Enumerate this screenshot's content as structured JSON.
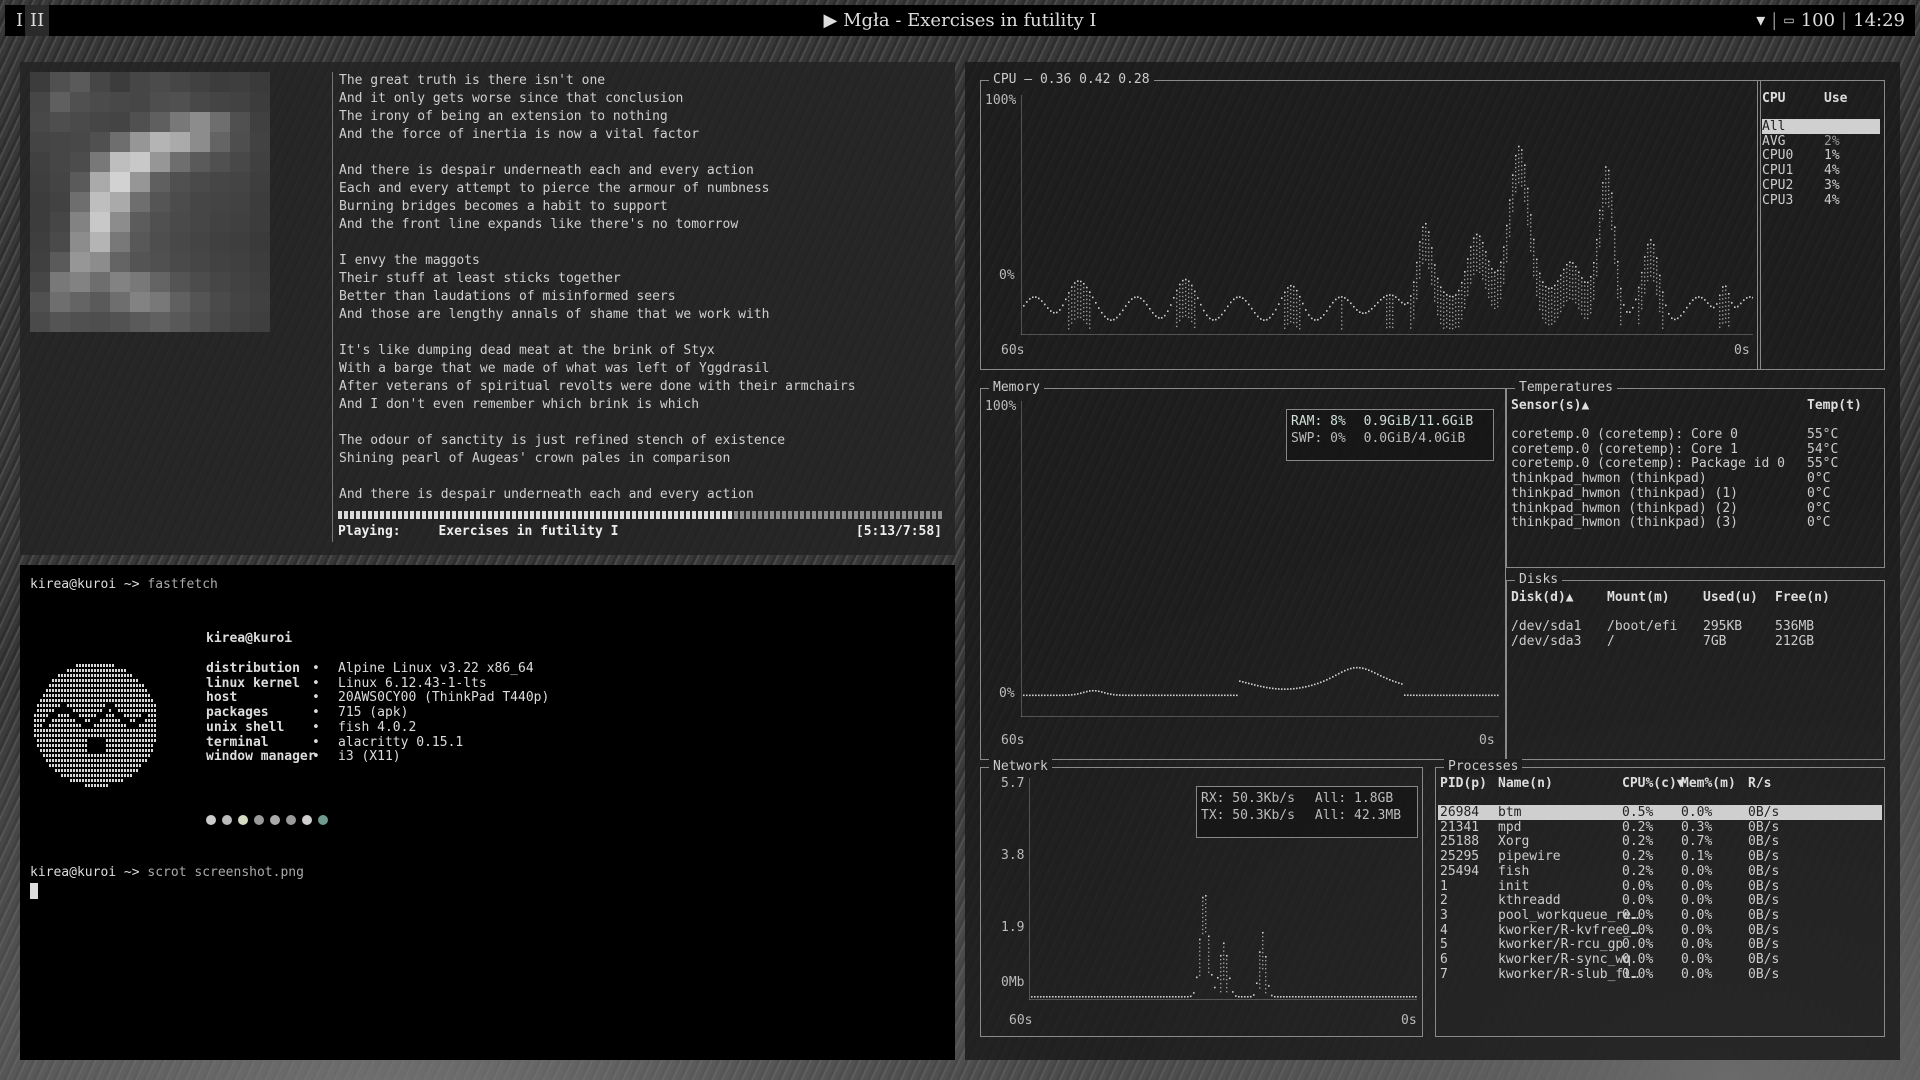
{
  "topbar": {
    "ws1": "I",
    "ws2": "II",
    "title": "▶ Mgła - Exercises in futility I",
    "battery": "100",
    "clock": "14:29"
  },
  "music": {
    "lyrics": [
      "The great truth is there isn't one",
      "And it only gets worse since that conclusion",
      "The irony of being an extension to nothing",
      "And the force of inertia is now a vital factor",
      "",
      "And there is despair underneath each and every action",
      "Each and every attempt to pierce the armour of numbness",
      "Burning bridges becomes a habit to support",
      "And the front line expands like there's no tomorrow",
      "",
      "I envy the maggots",
      "Their stuff at least sticks together",
      "Better than laudations of misinformed seers",
      "And those are lengthy annals of shame that we work with",
      "",
      "It's like dumping dead meat at the brink of Styx",
      "With a barge that we made of what was left of Yggdrasil",
      "After veterans of spiritual revolts were done with their armchairs",
      "And I don't even remember which brink is which",
      "",
      "The odour of sanctity is just refined stench of existence",
      "Shining pearl of Augeas' crown pales in comparison",
      "",
      "And there is despair underneath each and every action"
    ],
    "playing_label": "Playing:",
    "track": "Exercises in futility I",
    "time": "[5:13/7:58]",
    "progress": 0.655
  },
  "terminal": {
    "prompt1": "kirea@kuroi ~> ",
    "cmd1": "fastfetch",
    "user_host": "kirea@kuroi",
    "info": [
      {
        "label": "distribution",
        "value": "Alpine Linux v3.22 x86_64"
      },
      {
        "label": "linux kernel",
        "value": "Linux 6.12.43-1-lts"
      },
      {
        "label": "host",
        "value": "20AWS0CY00 (ThinkPad T440p)"
      },
      {
        "label": "packages",
        "value": "715 (apk)"
      },
      {
        "label": "unix shell",
        "value": "fish 4.0.2"
      },
      {
        "label": "terminal",
        "value": "alacritty 0.15.1"
      },
      {
        "label": "window manager",
        "value": "i3 (X11)"
      }
    ],
    "bullet": "•",
    "palette": [
      "#cccccc",
      "#bbbbbb",
      "#d6dcc4",
      "#999999",
      "#aaaaaa",
      "#9a9a9a",
      "#cfcfcf",
      "#6f9a8d"
    ],
    "prompt2": "kirea@kuroi ~> ",
    "cmd2": "scrot screenshot.png"
  },
  "btm": {
    "cpu": {
      "title": "CPU — 0.36 0.42 0.28",
      "y_max": "100%",
      "y_min": "0%",
      "x_left": "60s",
      "x_right": "0s",
      "table_head": [
        "CPU",
        "Use"
      ],
      "rows": [
        {
          "name": "All",
          "use": ""
        },
        {
          "name": "AVG",
          "use": "2%"
        },
        {
          "name": "CPU0",
          "use": "1%"
        },
        {
          "name": "CPU1",
          "use": "4%"
        },
        {
          "name": "CPU2",
          "use": "3%"
        },
        {
          "name": "CPU3",
          "use": "4%"
        }
      ]
    },
    "memory": {
      "title": "Memory",
      "y_max": "100%",
      "y_min": "0%",
      "x_left": "60s",
      "x_right": "0s",
      "ram_label": "RAM:",
      "ram_pct": "8%",
      "ram_val": "0.9GiB/11.6GiB",
      "swp_label": "SWP:",
      "swp_pct": "0%",
      "swp_val": "0.0GiB/4.0GiB"
    },
    "temps": {
      "title": "Temperatures",
      "head_sensor": "Sensor(s)▲",
      "head_temp": "Temp(t)",
      "rows": [
        {
          "sensor": "coretemp.0 (coretemp): Core 0",
          "temp": "55°C"
        },
        {
          "sensor": "coretemp.0 (coretemp): Core 1",
          "temp": "54°C"
        },
        {
          "sensor": "coretemp.0 (coretemp): Package id 0",
          "temp": "55°C"
        },
        {
          "sensor": "thinkpad_hwmon (thinkpad)",
          "temp": "0°C"
        },
        {
          "sensor": "thinkpad_hwmon (thinkpad) (1)",
          "temp": "0°C"
        },
        {
          "sensor": "thinkpad_hwmon (thinkpad) (2)",
          "temp": "0°C"
        },
        {
          "sensor": "thinkpad_hwmon (thinkpad) (3)",
          "temp": "0°C"
        }
      ]
    },
    "disks": {
      "title": "Disks",
      "head": [
        "Disk(d)▲",
        "Mount(m)",
        "Used(u)",
        "Free(n)"
      ],
      "rows": [
        [
          "/dev/sda1",
          "/boot/efi",
          "295KB",
          "536MB"
        ],
        [
          "/dev/sda3",
          "/",
          "7GB",
          "212GB"
        ]
      ]
    },
    "network": {
      "title": "Network",
      "y_labels": [
        "5.7",
        "3.8",
        "1.9",
        "0Mb"
      ],
      "x_left": "60s",
      "x_right": "0s",
      "rx": "RX: 50.3Kb/s",
      "rx_all": "All: 1.8GB",
      "tx": "TX: 50.3Kb/s",
      "tx_all": "All: 42.3MB"
    },
    "processes": {
      "title": "Processes",
      "head": [
        "PID(p)",
        "Name(n)",
        "CPU%(c)▼",
        "Mem%(m)",
        "R/s"
      ],
      "rows": [
        [
          "26984",
          "btm",
          "0.5%",
          "0.0%",
          "0B/s"
        ],
        [
          "21341",
          "mpd",
          "0.2%",
          "0.3%",
          "0B/s"
        ],
        [
          "25188",
          "Xorg",
          "0.2%",
          "0.7%",
          "0B/s"
        ],
        [
          "25295",
          "pipewire",
          "0.2%",
          "0.1%",
          "0B/s"
        ],
        [
          "25494",
          "fish",
          "0.2%",
          "0.0%",
          "0B/s"
        ],
        [
          "1",
          "init",
          "0.0%",
          "0.0%",
          "0B/s"
        ],
        [
          "2",
          "kthreadd",
          "0.0%",
          "0.0%",
          "0B/s"
        ],
        [
          "3",
          "pool_workqueue_re…",
          "0.0%",
          "0.0%",
          "0B/s"
        ],
        [
          "4",
          "kworker/R-kvfree_…",
          "0.0%",
          "0.0%",
          "0B/s"
        ],
        [
          "5",
          "kworker/R-rcu_gp",
          "0.0%",
          "0.0%",
          "0B/s"
        ],
        [
          "6",
          "kworker/R-sync_wq",
          "0.0%",
          "0.0%",
          "0B/s"
        ],
        [
          "7",
          "kworker/R-slub_fl…",
          "0.0%",
          "0.0%",
          "0B/s"
        ]
      ]
    }
  }
}
